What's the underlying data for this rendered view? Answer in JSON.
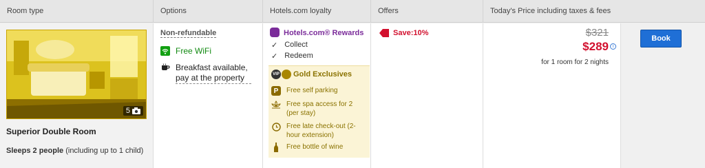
{
  "header": {
    "room_type": "Room type",
    "options": "Options",
    "loyalty": "Hotels.com loyalty",
    "offers": "Offers",
    "price": "Today's Price including taxes & fees"
  },
  "room": {
    "photo_count": "5",
    "name": "Superior Double Room",
    "sleeps_bold": "Sleeps 2 people",
    "sleeps_rest": " (including up to 1 child)"
  },
  "options": {
    "non_refundable": "Non-refundable",
    "wifi": "Free WiFi",
    "breakfast": "Breakfast available, pay at the property"
  },
  "loyalty": {
    "rewards_title": "Hotels.com® Rewards",
    "collect": "Collect",
    "redeem": "Redeem",
    "vip_label": "VIP",
    "gold_title": "Gold Exclusives",
    "perks": [
      {
        "icon": "parking-icon",
        "text": "Free self parking"
      },
      {
        "icon": "spa-icon",
        "text": "Free spa access for 2 (per stay)"
      },
      {
        "icon": "clock-icon",
        "text": "Free late check-out (2-hour extension)"
      },
      {
        "icon": "wine-bottle-icon",
        "text": "Free bottle of wine"
      }
    ]
  },
  "offers": {
    "save": "Save:10%"
  },
  "price": {
    "old": "$321",
    "new": "$289",
    "note": "for 1 room for 2 nights"
  },
  "book": {
    "label": "Book"
  },
  "colors": {
    "accent_red": "#d2102e",
    "rewards_purple": "#7b2c9a",
    "wifi_green": "#12a012",
    "book_blue": "#1f6fd6",
    "gold": "#8a7200"
  }
}
